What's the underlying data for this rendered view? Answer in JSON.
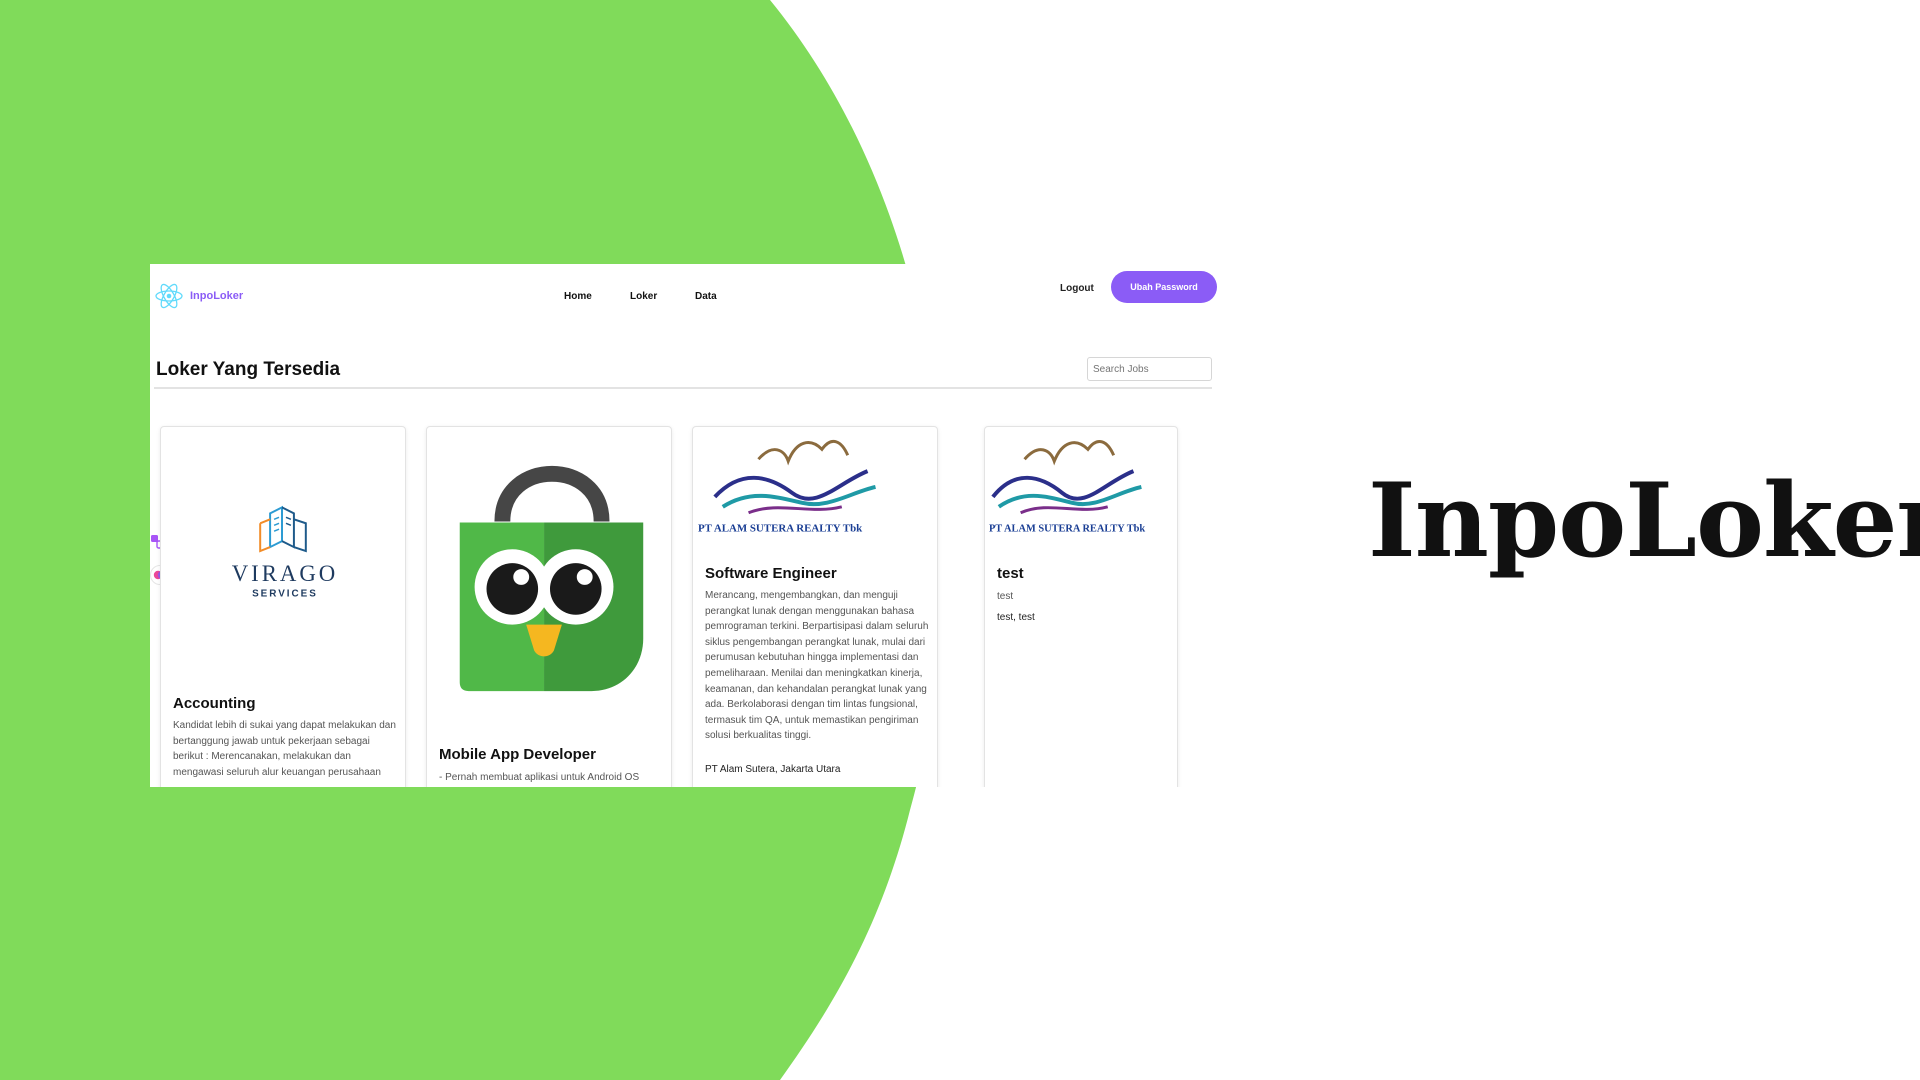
{
  "hero_title": "InpoLoker",
  "colors": {
    "green": "#80db5a",
    "accent": "#8b5cf6",
    "text": "#111111"
  },
  "app": {
    "logo_text": "InpoLoker",
    "logo_icon": "react-atom-icon"
  },
  "nav": {
    "home": "Home",
    "loker": "Loker",
    "data": "Data",
    "logout": "Logout",
    "change_password": "Ubah Password"
  },
  "page": {
    "title": "Loker Yang Tersedia",
    "search_placeholder": "Search Jobs"
  },
  "jobs": [
    {
      "title": "Accounting",
      "logo_text": "VIRAGO",
      "logo_subtext": "SERVICES",
      "description": "Kandidat lebih di sukai yang dapat melakukan dan bertanggung jawab untuk pekerjaan sebagai berikut : Merencanakan, melakukan dan mengawasi seluruh alur keuangan perusahaan",
      "location": ""
    },
    {
      "title": "Mobile App Developer",
      "logo_text": "",
      "logo_subtext": "",
      "description": "- Pernah membuat aplikasi untuk Android OS",
      "location": ""
    },
    {
      "title": "Software Engineer",
      "logo_text": "PT  ALAM SUTERA REALTY Tbk",
      "logo_subtext": "",
      "description": "Merancang, mengembangkan, dan menguji perangkat lunak dengan menggunakan bahasa pemrograman terkini. Berpartisipasi dalam seluruh siklus pengembangan perangkat lunak, mulai dari perumusan kebutuhan hingga implementasi dan pemeliharaan. Menilai dan meningkatkan kinerja, keamanan, dan kehandalan perangkat lunak yang ada. Berkolaborasi dengan tim lintas fungsional, termasuk tim QA, untuk memastikan pengiriman solusi berkualitas tinggi.",
      "location": "PT Alam Sutera, Jakarta Utara"
    },
    {
      "title": "test",
      "logo_text": "PT  ALAM SUTERA REALTY Tbk",
      "logo_subtext": "",
      "description": "test",
      "location": "test, test"
    }
  ]
}
